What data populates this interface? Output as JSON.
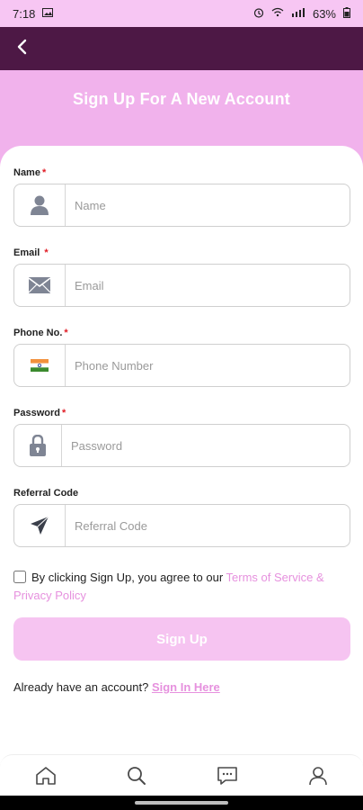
{
  "status_bar": {
    "time": "7:18",
    "battery": "63%"
  },
  "header": {
    "title": "Sign Up For A New Account"
  },
  "form": {
    "fields": [
      {
        "label": "Name",
        "required": "*",
        "placeholder": "Name"
      },
      {
        "label": "Email",
        "required": "*",
        "placeholder": "Email"
      },
      {
        "label": "Phone No.",
        "required": "*",
        "placeholder": "Phone Number"
      },
      {
        "label": "Password",
        "required": "*",
        "placeholder": "Password"
      },
      {
        "label": "Referral Code",
        "required": "",
        "placeholder": "Referral Code"
      }
    ],
    "terms_text": "By clicking Sign Up, you agree to our ",
    "terms_link": "Terms of Service & Privacy Policy",
    "signup_label": "Sign Up",
    "already_text": "Already have an account? ",
    "signin_link": "Sign In Here"
  },
  "bottom_nav": {
    "items": [
      "home-icon",
      "search-icon",
      "messages-icon",
      "profile-icon"
    ]
  },
  "colors": {
    "status_bar": "#f7c6f3",
    "topbar": "#4d1845",
    "hero": "#f1b2ec",
    "accent": "#e691de",
    "button": "#f6c4f1"
  }
}
